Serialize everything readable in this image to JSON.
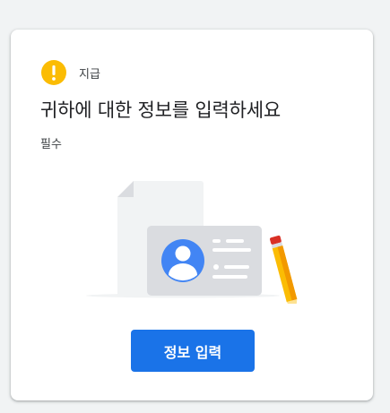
{
  "card": {
    "badge": {
      "icon": "exclamation-icon",
      "label": "지급",
      "color": "#fbbc04"
    },
    "title": "귀하에 대한 정보를 입력하세요",
    "subtitle": "필수",
    "illustration": "id-card-with-pencil-illustration",
    "cta": {
      "label": "정보 입력",
      "color": "#1a73e8"
    }
  }
}
